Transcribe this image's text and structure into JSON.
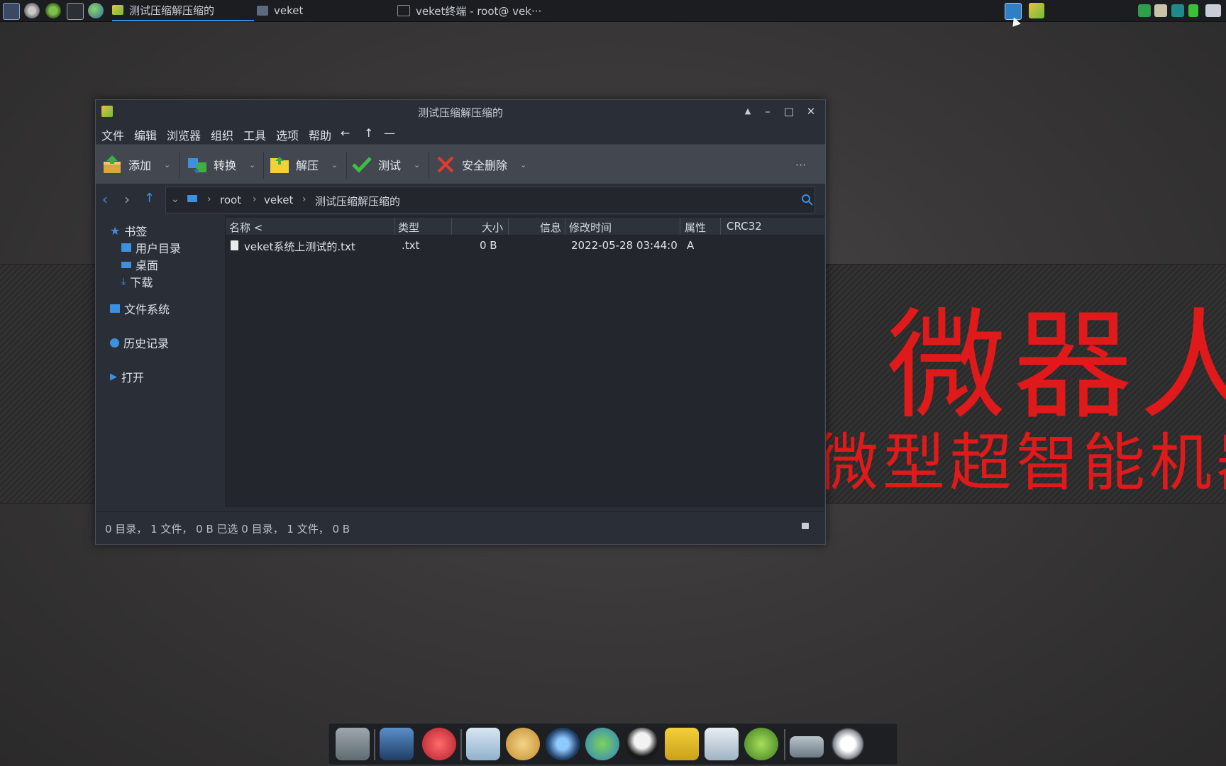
{
  "taskbar": {
    "tasks": [
      {
        "label": "测试压缩解压缩的",
        "active": true
      },
      {
        "label": "veket",
        "active": false
      },
      {
        "label": "veket终端 - root@ vek···",
        "active": false
      }
    ]
  },
  "wallpaper": {
    "big_text": "微器人",
    "sub_text": "微型超智能机器"
  },
  "window": {
    "title": "测试压缩解压缩的",
    "menu": [
      "文件",
      "编辑",
      "浏览器",
      "组织",
      "工具",
      "选项",
      "帮助"
    ],
    "menu_arrows": [
      "←",
      "↑",
      "—"
    ],
    "toolbar": {
      "add": "添加",
      "convert": "转换",
      "extract": "解压",
      "test": "测试",
      "safe_delete": "安全删除",
      "more": "···"
    },
    "path": [
      "root",
      "veket",
      "测试压缩解压缩的"
    ],
    "sidebar": {
      "bookmarks": "书签",
      "home": "用户目录",
      "desktop": "桌面",
      "downloads": "下载",
      "filesystem": "文件系统",
      "history": "历史记录",
      "open": "打开"
    },
    "columns": {
      "name": "名称 <",
      "type": "类型",
      "size": "大小",
      "info": "信息",
      "modified": "修改时间",
      "attr": "属性",
      "crc": "CRC32"
    },
    "files": [
      {
        "name": "veket系统上测试的.txt",
        "type": ".txt",
        "size": "0 B",
        "info": "",
        "modified": "2022-05-28 03:44:0",
        "attr": "A",
        "crc": ""
      }
    ],
    "status": "0 目录， 1 文件， 0 B  已选 0 目录， 1 文件， 0 B"
  },
  "colors": {
    "accent": "#3d8fe0",
    "wallpaper_text": "#e01a1a"
  }
}
